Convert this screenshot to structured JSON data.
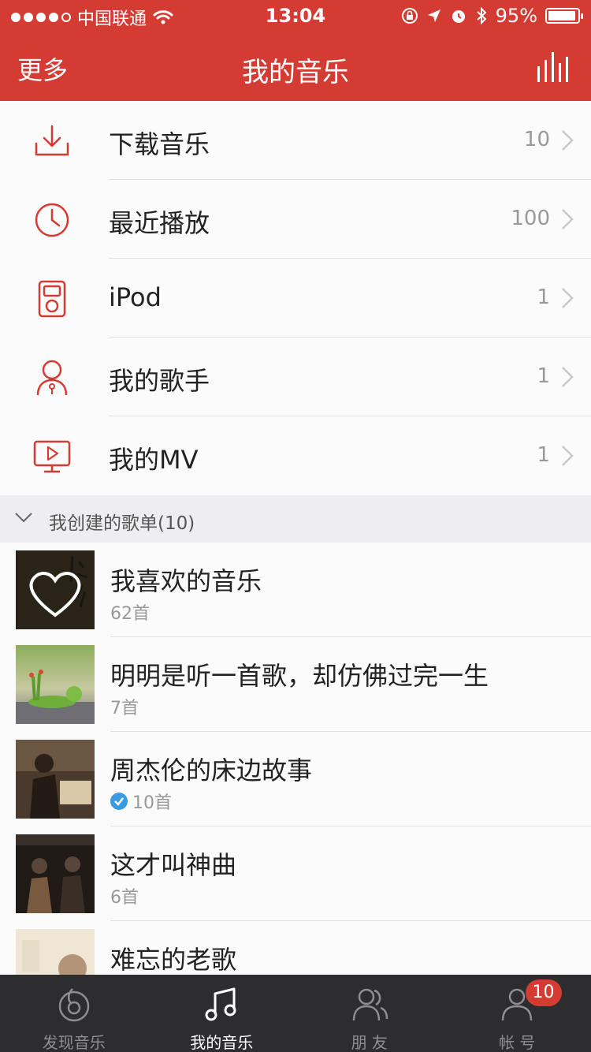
{
  "status_bar": {
    "carrier": "中国联通",
    "time": "13:04",
    "battery": "95%",
    "battery_level": 0.95,
    "signal_bars": 4,
    "icons": [
      "wifi-icon",
      "lock-rotation-icon",
      "location-icon",
      "alarm-icon",
      "bluetooth-icon",
      "battery-icon"
    ]
  },
  "nav": {
    "left_label": "更多",
    "title": "我的音乐",
    "right_icon": "equalizer-icon"
  },
  "menu_items": [
    {
      "label": "下载音乐",
      "count": "10",
      "icon": "download-icon"
    },
    {
      "label": "最近播放",
      "count": "100",
      "icon": "clock-icon"
    },
    {
      "label": "iPod",
      "count": "1",
      "icon": "ipod-icon"
    },
    {
      "label": "我的歌手",
      "count": "1",
      "icon": "singer-icon"
    },
    {
      "label": "我的MV",
      "count": "1",
      "icon": "mv-icon"
    }
  ],
  "section": {
    "title": "我创建的歌单(10)",
    "icon": "chevron-down-icon"
  },
  "playlists": [
    {
      "name": "我喜欢的音乐",
      "count": "62首",
      "verified": false
    },
    {
      "name": "明明是听一首歌，却仿佛过完一生",
      "count": "7首",
      "verified": false
    },
    {
      "name": "周杰伦的床边故事",
      "count": "10首",
      "verified": true
    },
    {
      "name": "这才叫神曲",
      "count": "6首",
      "verified": false
    },
    {
      "name": "难忘的老歌",
      "count": "",
      "verified": false
    }
  ],
  "tabs": [
    {
      "label": "发现音乐",
      "icon": "discover-music-icon",
      "active": false,
      "badge": ""
    },
    {
      "label": "我的音乐",
      "icon": "music-note-icon",
      "active": true,
      "badge": ""
    },
    {
      "label": "朋 友",
      "icon": "friends-icon",
      "active": false,
      "badge": ""
    },
    {
      "label": "帐 号",
      "icon": "account-icon",
      "active": false,
      "badge": "10"
    }
  ],
  "colors": {
    "brand_red": "#d43c33",
    "tabbar_bg": "#2d2d2f",
    "verified_blue": "#3a9be0"
  }
}
